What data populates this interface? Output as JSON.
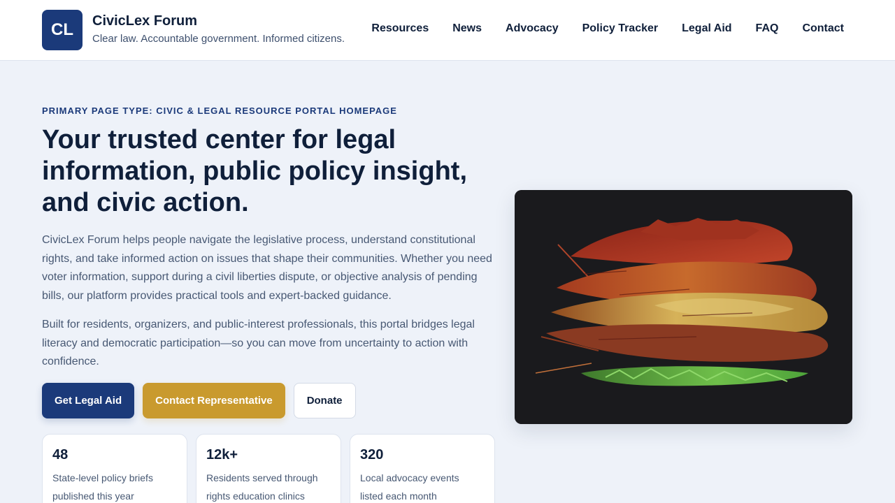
{
  "header": {
    "logo_text": "CL",
    "brand_name": "CivicLex Forum",
    "tagline": "Clear law. Accountable government. Informed citizens.",
    "nav": [
      "Resources",
      "News",
      "Advocacy",
      "Policy Tracker",
      "Legal Aid",
      "FAQ",
      "Contact"
    ]
  },
  "hero": {
    "eyebrow": "PRIMARY PAGE TYPE: CIVIC & LEGAL RESOURCE PORTAL HOMEPAGE",
    "title": "Your trusted center for legal information, public policy insight, and civic action.",
    "paragraph_1": "CivicLex Forum helps people navigate the legislative process, understand constitutional rights, and take informed action on issues that shape their communities. Whether you need voter information, support during a civil liberties dispute, or objective analysis of pending bills, our platform provides practical tools and expert-backed guidance.",
    "paragraph_2": "Built for residents, organizers, and public-interest professionals, this portal bridges legal literacy and democratic participation—so you can move from uncertainty to action with confidence.",
    "buttons": {
      "primary": "Get Legal Aid",
      "secondary": "Contact Representative",
      "tertiary": "Donate"
    },
    "image_icon": "autumn-leaves-photo"
  },
  "stats": [
    {
      "value": "48",
      "label": "State-level policy briefs published this year"
    },
    {
      "value": "12k+",
      "label": "Residents served through rights education clinics"
    },
    {
      "value": "320",
      "label": "Local advocacy events listed each month"
    }
  ],
  "colors": {
    "brand": "#1b3a7a",
    "gold": "#c99a2e",
    "background": "#eef2f9",
    "text": "#0f1f3a"
  }
}
